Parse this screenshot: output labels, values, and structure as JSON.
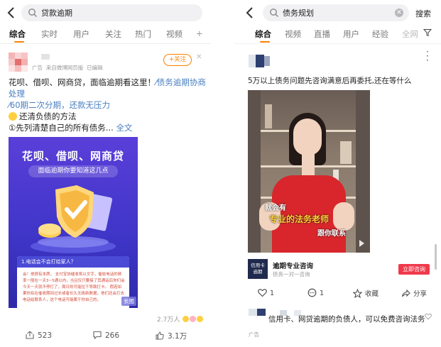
{
  "left": {
    "search": {
      "query": "贷款逾期"
    },
    "tabs": [
      {
        "label": "综合",
        "active": true
      },
      {
        "label": "实时"
      },
      {
        "label": "用户"
      },
      {
        "label": "关注"
      },
      {
        "label": "热门"
      },
      {
        "label": "视频"
      },
      {
        "label": "+"
      }
    ],
    "post": {
      "ad_label": "广告",
      "source": "来自微博网页版",
      "edited": "已编辑",
      "follow_label": "+关注",
      "line1": "花呗、借呗、网商贷，面临逾期看这里！",
      "topic": "⁄债务逾期协商处理",
      "line3_link": "⁄60期二次分期，还款无压力",
      "line4": "还清负债的方法",
      "line5": "①先列清楚自己的所有债务...",
      "full_text": "全文",
      "poster": {
        "title": "花呗、借呗、网商贷",
        "subtitle": "面临逾期你要知道这几点",
        "card_head": "1.电话会不会打给家人？",
        "card_text": "会！他很有本质，\n支付宝协催收将以文字，催收电话的频率一般在一天3~5通以内，当且仅只要接了其通话后你们会今天一天就不停打了，周日则可能拉下导致打卡。\n假若如果你有在催收期间过长或者长久无极新数据，他们还会打去电话给联系人，这个电话可能属于你自己的。",
        "long_tag": "长图"
      },
      "views": "2.7万人",
      "actions": {
        "share": "523",
        "comment": "266",
        "like": "3.1万"
      }
    }
  },
  "right": {
    "search": {
      "query": "债务规划",
      "button": "搜索"
    },
    "tabs": [
      {
        "label": "综合",
        "active": true
      },
      {
        "label": "视频"
      },
      {
        "label": "直播"
      },
      {
        "label": "用户"
      },
      {
        "label": "经验"
      },
      {
        "label": "全网"
      }
    ],
    "post": {
      "text": "5万以上债务问题先咨询满意后再委托,还在等什么",
      "video_subtitles": [
        "就会有",
        "专业的法务老师",
        "跟你联系"
      ],
      "ad": {
        "logo_text": "信用卡 逾期",
        "title": "逾期专业咨询",
        "subtitle": "债务一对一咨询",
        "button": "立即咨询"
      },
      "actions": {
        "like": "1",
        "comment": "1",
        "favorite": "收藏",
        "share": "分享"
      }
    },
    "post2": {
      "text": "信用卡、网贷逾期的负债人，可以免费咨询法务",
      "ad_label": "广告"
    }
  },
  "colors": {
    "accent": "#ff8200",
    "link": "#4a7fc1",
    "ad_button": "#f03a4c"
  }
}
